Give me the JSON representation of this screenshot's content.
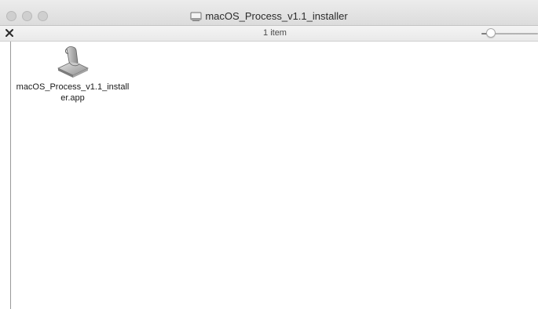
{
  "window": {
    "title": "macOS_Process_v1.1_installer",
    "title_icon": "drive-icon"
  },
  "statusbar": {
    "item_count": "1 item",
    "close_icon": "close-x-icon",
    "icon_size_slider": 0.1
  },
  "files": [
    {
      "name_line1": "macOS_Process_v1.1_install",
      "name_line2": "er.app",
      "icon": "installer-app-icon"
    }
  ],
  "colors": {
    "titlebar": "#dcdcdc",
    "window_bg": "#ffffff",
    "traffic_light": "#cfcfcf"
  }
}
